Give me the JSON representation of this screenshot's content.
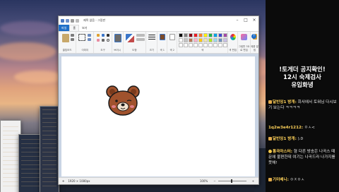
{
  "paint": {
    "title": "제목 없음 - 그림판",
    "tabs": [
      "파일",
      "홈",
      "보기"
    ],
    "groups": [
      "클립보드",
      "이미지",
      "도구",
      "브러시",
      "도형",
      "크기",
      "색 1",
      "색 2",
      "색",
      "색 편집",
      "그림판 3D로 편집",
      "제품 알림"
    ],
    "status_size": "1920 × 1080px",
    "zoom_level": "100%"
  },
  "colors": {
    "palette": [
      "#000000",
      "#7f7f7f",
      "#880015",
      "#ed1c24",
      "#ff7f27",
      "#fff200",
      "#22b14c",
      "#00a2e8",
      "#3f48cc",
      "#a349a4",
      "#ffffff",
      "#c3c3c3",
      "#b97a57",
      "#ffaec9",
      "#ffc90e",
      "#efe4b0",
      "#b5e61d",
      "#99d9ea",
      "#7092be",
      "#c8bfe7",
      "#ffffff",
      "#ffffff",
      "#ffffff",
      "#ffffff",
      "#ffffff",
      "#ffffff",
      "#ffffff",
      "#ffffff",
      "#ffffff",
      "#ffffff"
    ],
    "bear_fur": "#a0522d",
    "chat_nick": "#ffd35a"
  },
  "chat": {
    "notice": "!토게더 공지확인!\n12시 숙제검사\n유입화녕",
    "messages": [
      {
        "nick": "달빈잉1 방개:",
        "text": "회사에서 토워님 다시보기 보는다 ㅋㅋㅋㅋ",
        "badge": "crown-icon"
      },
      {
        "nick": "1q2w3e4r1212:",
        "text": "ㅇㅅ<",
        "badge": ""
      },
      {
        "nick": "달빈잉1 방개:",
        "text": ").0",
        "badge": "crown-icon"
      },
      {
        "nick": "통곡마스터:",
        "text": "형 다른 방송은 나곡스 때문에 불편한데 여기는 나곡드라 나가지를 못해!",
        "badge": "smile-icon"
      },
      {
        "nick": "기미베니:",
        "text": "ㅇㅈㅇㅅ",
        "badge": "crown-icon"
      }
    ]
  }
}
